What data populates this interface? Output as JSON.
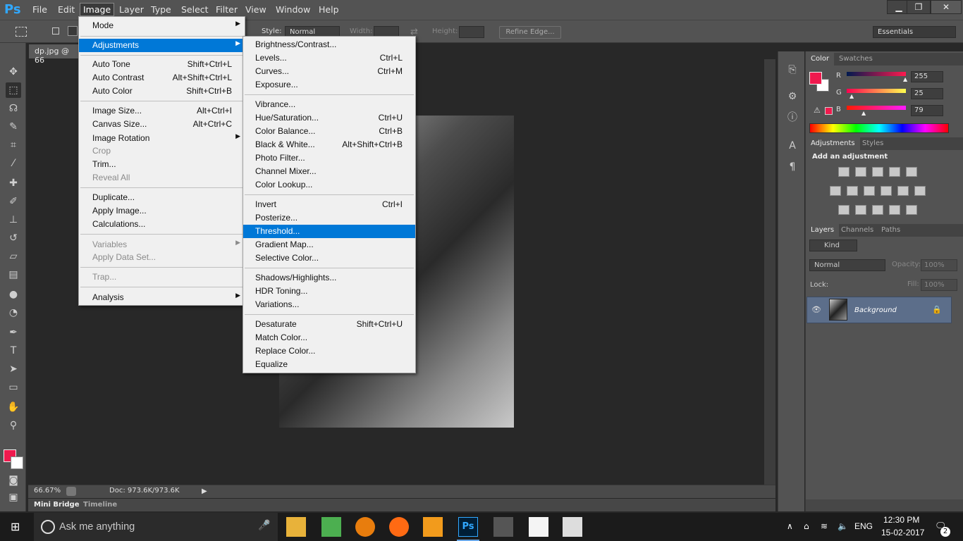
{
  "app": {
    "logo": "Ps",
    "menu": [
      "File",
      "Edit",
      "Image",
      "Layer",
      "Type",
      "Select",
      "Filter",
      "View",
      "Window",
      "Help"
    ],
    "window_buttons": [
      "▁",
      "❐",
      "✕"
    ]
  },
  "options": {
    "style_label": "Style:",
    "style_value": "Normal",
    "width_label": "Width:",
    "height_label": "Height:",
    "refine_edge": "Refine Edge...",
    "workspace": "Essentials"
  },
  "document": {
    "tab_title": "dp.jpg @ 66",
    "zoom": "66.67%",
    "doc_info": "Doc: 973.6K/973.6K",
    "bottom_tabs": [
      "Mini Bridge",
      "Timeline"
    ]
  },
  "image_menu": {
    "items": [
      {
        "label": "Mode",
        "submenu": true
      },
      {
        "label": "Adjustments",
        "submenu": true,
        "highlighted": true
      },
      {
        "label": "Auto Tone",
        "shortcut": "Shift+Ctrl+L"
      },
      {
        "label": "Auto Contrast",
        "shortcut": "Alt+Shift+Ctrl+L"
      },
      {
        "label": "Auto Color",
        "shortcut": "Shift+Ctrl+B"
      },
      {
        "label": "Image Size...",
        "shortcut": "Alt+Ctrl+I"
      },
      {
        "label": "Canvas Size...",
        "shortcut": "Alt+Ctrl+C"
      },
      {
        "label": "Image Rotation",
        "submenu": true
      },
      {
        "label": "Crop",
        "disabled": true
      },
      {
        "label": "Trim..."
      },
      {
        "label": "Reveal All",
        "disabled": true
      },
      {
        "label": "Duplicate..."
      },
      {
        "label": "Apply Image..."
      },
      {
        "label": "Calculations..."
      },
      {
        "label": "Variables",
        "submenu": true,
        "disabled": true
      },
      {
        "label": "Apply Data Set...",
        "disabled": true
      },
      {
        "label": "Trap...",
        "disabled": true
      },
      {
        "label": "Analysis",
        "submenu": true
      }
    ]
  },
  "adjust_menu": {
    "items": [
      {
        "label": "Brightness/Contrast..."
      },
      {
        "label": "Levels...",
        "shortcut": "Ctrl+L"
      },
      {
        "label": "Curves...",
        "shortcut": "Ctrl+M"
      },
      {
        "label": "Exposure..."
      },
      {
        "label": "Vibrance..."
      },
      {
        "label": "Hue/Saturation...",
        "shortcut": "Ctrl+U"
      },
      {
        "label": "Color Balance...",
        "shortcut": "Ctrl+B"
      },
      {
        "label": "Black & White...",
        "shortcut": "Alt+Shift+Ctrl+B"
      },
      {
        "label": "Photo Filter..."
      },
      {
        "label": "Channel Mixer..."
      },
      {
        "label": "Color Lookup..."
      },
      {
        "label": "Invert",
        "shortcut": "Ctrl+I"
      },
      {
        "label": "Posterize..."
      },
      {
        "label": "Threshold...",
        "highlighted": true
      },
      {
        "label": "Gradient Map..."
      },
      {
        "label": "Selective Color..."
      },
      {
        "label": "Shadows/Highlights..."
      },
      {
        "label": "HDR Toning..."
      },
      {
        "label": "Variations..."
      },
      {
        "label": "Desaturate",
        "shortcut": "Shift+Ctrl+U"
      },
      {
        "label": "Match Color..."
      },
      {
        "label": "Replace Color..."
      },
      {
        "label": "Equalize"
      }
    ]
  },
  "color_panel": {
    "tabs": [
      "Color",
      "Swatches"
    ],
    "r_label": "R",
    "g_label": "G",
    "b_label": "B",
    "r": "255",
    "g": "25",
    "b": "79",
    "foreground": "#f01a4e"
  },
  "adjustments_panel": {
    "tabs": [
      "Adjustments",
      "Styles"
    ],
    "heading": "Add an adjustment"
  },
  "layers_panel": {
    "tabs": [
      "Layers",
      "Channels",
      "Paths"
    ],
    "kind": "Kind",
    "blend_mode": "Normal",
    "opacity_label": "Opacity:",
    "opacity": "100%",
    "lock_label": "Lock:",
    "fill_label": "Fill:",
    "fill": "100%",
    "layer_name": "Background"
  },
  "taskbar": {
    "search_placeholder": "Ask me anything",
    "language": "ENG",
    "time": "12:30 PM",
    "date": "15-02-2017",
    "notification_count": "2"
  }
}
